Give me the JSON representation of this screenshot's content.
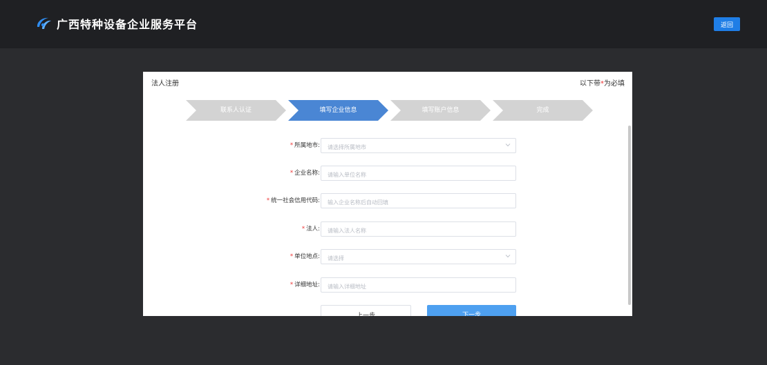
{
  "header": {
    "title": "广西特种设备企业服务平台",
    "back_label": "返回"
  },
  "panel": {
    "title": "法人注册",
    "required_note_prefix": "以下带",
    "required_star": "*",
    "required_note_suffix": "为必填"
  },
  "steps": [
    {
      "label": "联系人认证",
      "state": "inactive"
    },
    {
      "label": "填写企业信息",
      "state": "active"
    },
    {
      "label": "填写账户信息",
      "state": "inactive"
    },
    {
      "label": "完成",
      "state": "inactive"
    }
  ],
  "colors": {
    "step_active": "#4a86d4",
    "step_inactive": "#d3d3d3",
    "accent": "#1f7ee6"
  },
  "form": {
    "city": {
      "label": "所属地市:",
      "placeholder": "请选择所属地市"
    },
    "company_name": {
      "label": "企业名称:",
      "placeholder": "请输入单位名称"
    },
    "credit_code": {
      "label": "统一社会信用代码:",
      "placeholder": "输入企业名称后自动回填"
    },
    "legal_person": {
      "label": "法人:",
      "placeholder": "请输入法人名称"
    },
    "location": {
      "label": "单位地点:",
      "placeholder": "请选择"
    },
    "address": {
      "label": "详细地址:",
      "placeholder": "请输入详细地址"
    }
  },
  "buttons": {
    "prev": "上一步",
    "next": "下一步"
  }
}
